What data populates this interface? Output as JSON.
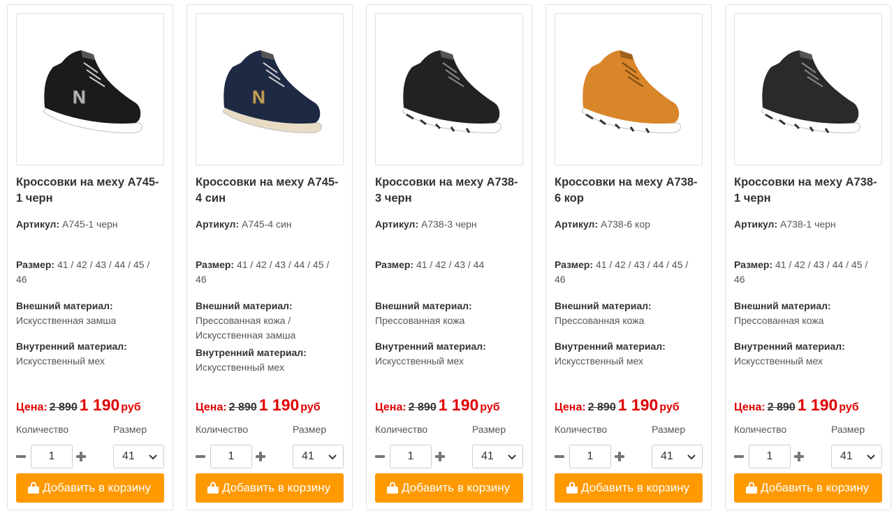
{
  "labels": {
    "article": "Артикул:",
    "size": "Размер:",
    "outer": "Внешний материал:",
    "inner": "Внутренний материал:",
    "price": "Цена:",
    "currency": "руб",
    "quantity": "Количество",
    "size_select": "Размер",
    "add_to_cart": "Добавить в корзину"
  },
  "colors": {
    "accent": "#ff9900",
    "price": "#e00000"
  },
  "products": [
    {
      "title_line1": "Кроссовки на меху А745-",
      "title_line2": "1 черн",
      "article": "А745-1 черн",
      "sizes_line1": "41 / 42 / 43 / 44 / 45 /",
      "sizes_line2": "46",
      "outer_line1": "Искусственная замша",
      "outer_line2": "",
      "inner": "Искусственный мех",
      "old_price": "2 890",
      "new_price": "1 190",
      "qty": "1",
      "size": "41",
      "shoe_color": "#1b1b1b",
      "sole_color": "#ffffff",
      "logo": "N"
    },
    {
      "title_line1": "Кроссовки на меху А745-",
      "title_line2": "4 син",
      "article": "А745-4 син",
      "sizes_line1": "41 / 42 / 43 / 44 / 45 /",
      "sizes_line2": "46",
      "outer_line1": "Прессованная кожа /",
      "outer_line2": "Искусственная замша",
      "inner": "Искусственный мех",
      "old_price": "2 890",
      "new_price": "1 190",
      "qty": "1",
      "size": "41",
      "shoe_color": "#1e2a44",
      "sole_color": "#e8dcc5",
      "logo": "N"
    },
    {
      "title_line1": "Кроссовки на меху А738-",
      "title_line2": "3 черн",
      "article": "А738-3 черн",
      "sizes_line1": "41 / 42 / 43 / 44",
      "sizes_line2": "",
      "outer_line1": "Прессованная кожа",
      "outer_line2": "",
      "inner": "Искусственный мех",
      "old_price": "2 890",
      "new_price": "1 190",
      "qty": "1",
      "size": "41",
      "shoe_color": "#222222",
      "sole_color": "#ffffff",
      "logo": ""
    },
    {
      "title_line1": "Кроссовки на меху А738-",
      "title_line2": "6 кор",
      "article": "А738-6 кор",
      "sizes_line1": "41 / 42 / 43 / 44 / 45 /",
      "sizes_line2": "46",
      "outer_line1": "Прессованная кожа",
      "outer_line2": "",
      "inner": "Искусственный мех",
      "old_price": "2 890",
      "new_price": "1 190",
      "qty": "1",
      "size": "41",
      "shoe_color": "#d9862a",
      "sole_color": "#ffffff",
      "logo": ""
    },
    {
      "title_line1": "Кроссовки на меху А738-",
      "title_line2": "1 черн",
      "article": "А738-1 черн",
      "sizes_line1": "41 / 42 / 43 / 44 / 45 /",
      "sizes_line2": "46",
      "outer_line1": "Прессованная кожа",
      "outer_line2": "",
      "inner": "Искусственный мех",
      "old_price": "2 890",
      "new_price": "1 190",
      "qty": "1",
      "size": "41",
      "shoe_color": "#2a2a2a",
      "sole_color": "#ffffff",
      "logo": ""
    }
  ]
}
